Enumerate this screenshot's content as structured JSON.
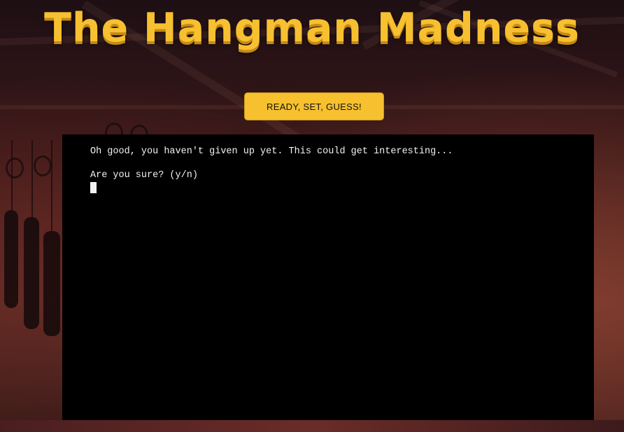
{
  "app": {
    "title": "The Hangman Madness"
  },
  "controls": {
    "start_label": "READY, SET, GUESS!"
  },
  "terminal": {
    "lines": [
      "Oh good, you haven't given up yet. This could get interesting...",
      "",
      "Are you sure? (y/n)"
    ]
  },
  "colors": {
    "accent": "#f6c02e",
    "terminal_bg": "#000000",
    "terminal_text": "#f2f2f2"
  }
}
